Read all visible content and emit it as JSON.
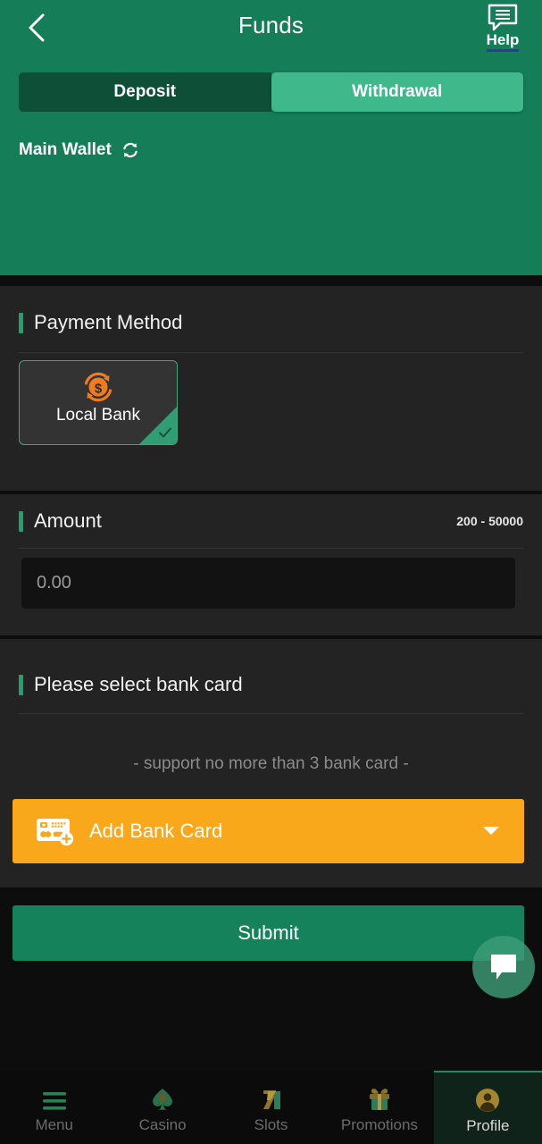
{
  "header": {
    "title": "Funds",
    "back_icon": "chevron-left-icon",
    "help_label": "Help",
    "help_icon": "speech-bubble-icon",
    "brand_green": "#157D58"
  },
  "tabs": [
    {
      "label": "Deposit",
      "active": false
    },
    {
      "label": "Withdrawal",
      "active": true
    }
  ],
  "wallet": {
    "label": "Main Wallet",
    "refresh_icon": "refresh-icon"
  },
  "payment_method": {
    "section_title": "Payment Method",
    "options": [
      {
        "name": "Local Bank",
        "icon": "money-exchange-icon",
        "selected": true,
        "icon_color": "#F07C1E"
      }
    ]
  },
  "amount": {
    "section_title": "Amount",
    "range_hint": "200 - 50000",
    "value": "",
    "placeholder": "0.00"
  },
  "bank_card": {
    "section_title": "Please select bank card",
    "note": "- support no more than 3 bank card -",
    "add_label": "Add Bank Card",
    "add_icon": "add-card-icon",
    "caret_icon": "chevron-down-icon",
    "accent": "#F9A81C"
  },
  "actions": {
    "submit_label": "Submit",
    "submit_color": "#15825C"
  },
  "chat": {
    "icon": "chat-bubble-icon"
  },
  "bottom_nav": [
    {
      "label": "Menu",
      "icon": "hamburger-icon",
      "active": false
    },
    {
      "label": "Casino",
      "icon": "spade-icon",
      "active": false
    },
    {
      "label": "Slots",
      "icon": "slot-seven-icon",
      "active": false
    },
    {
      "label": "Promotions",
      "icon": "gift-icon",
      "active": false
    },
    {
      "label": "Profile",
      "icon": "avatar-icon",
      "active": true
    }
  ]
}
